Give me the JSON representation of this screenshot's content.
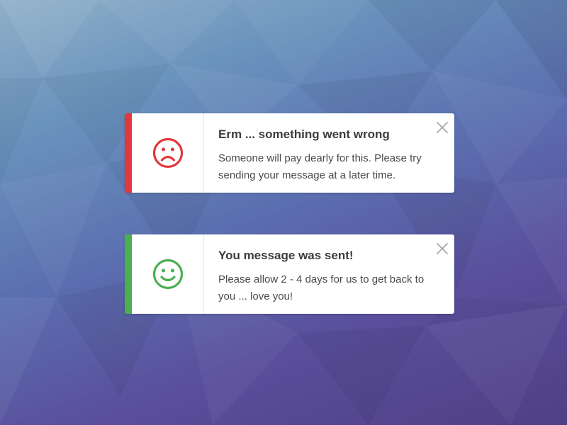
{
  "colors": {
    "error_accent": "#e0383e",
    "success_accent": "#4caf50"
  },
  "notifications": [
    {
      "type": "error",
      "icon": "sad-face-icon",
      "title": "Erm ... something went wrong",
      "message": "Someone will pay dearly for this. Please try sending your message at a later time.",
      "close_icon": "close-icon"
    },
    {
      "type": "success",
      "icon": "smiley-face-icon",
      "title": "You message was sent!",
      "message": "Please allow 2 - 4 days for us to get back to you ... love you!",
      "close_icon": "close-icon"
    }
  ]
}
